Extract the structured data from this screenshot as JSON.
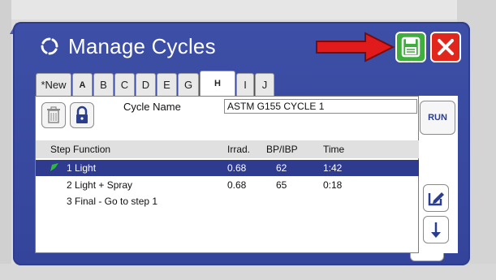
{
  "window": {
    "title": "Manage Cycles",
    "save_icon": "floppy-disk-icon",
    "close_icon": "close-x-icon",
    "arrow_icon": "red-arrow-pointer-icon"
  },
  "colors": {
    "panel": "#3d4fa6",
    "save": "#3fae3d",
    "close": "#e1261c",
    "selected_row": "#2f3b8f",
    "arrow": "#e11b1b"
  },
  "tabs": [
    {
      "label": "*New",
      "active": false
    },
    {
      "label": "A",
      "active": false
    },
    {
      "label": "B",
      "active": false
    },
    {
      "label": "C",
      "active": false
    },
    {
      "label": "D",
      "active": false
    },
    {
      "label": "E",
      "active": false
    },
    {
      "label": "G",
      "active": false
    },
    {
      "label": "H",
      "active": true
    },
    {
      "label": "I",
      "active": false
    },
    {
      "label": "J",
      "active": false
    }
  ],
  "editor": {
    "cycle_name_label": "Cycle Name",
    "cycle_name_value": "ASTM G155 CYCLE 1",
    "run_label": "RUN"
  },
  "table": {
    "headers": {
      "step_function": "Step Function",
      "irrad": "Irrad.",
      "bp": "BP/IBP",
      "time": "Time"
    },
    "rows": [
      {
        "step": "1 Light",
        "irrad": "0.68",
        "bp": "62",
        "time": "1:42",
        "selected": true
      },
      {
        "step": "2 Light + Spray",
        "irrad": "0.68",
        "bp": "65",
        "time": "0:18",
        "selected": false
      },
      {
        "step": "3 Final - Go to step 1",
        "irrad": "",
        "bp": "",
        "time": "",
        "selected": false
      }
    ]
  }
}
